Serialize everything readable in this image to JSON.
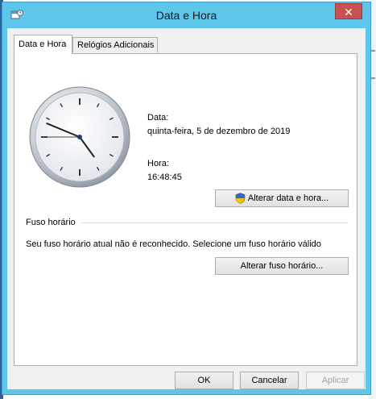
{
  "window": {
    "title": "Data e Hora",
    "close_glyph": "✕",
    "icon": "datetime-settings-icon"
  },
  "tabs": [
    {
      "label": "Data e Hora",
      "active": true
    },
    {
      "label": "Relógios Adicionais",
      "active": false
    }
  ],
  "clock": {
    "time": "16:48:45"
  },
  "date": {
    "label": "Data:",
    "value": "quinta-feira, 5 de dezembro de 2019"
  },
  "time": {
    "label": "Hora:",
    "value": "16:48:45"
  },
  "change_datetime_button": {
    "label": "Alterar data e hora...",
    "icon": "uac-shield-icon"
  },
  "timezone": {
    "group_label": "Fuso horário",
    "message": "Seu fuso horário atual não é reconhecido. Selecione um fuso horário válido",
    "button_label": "Alterar fuso horário..."
  },
  "footer": {
    "ok": "OK",
    "cancel": "Cancelar",
    "apply": "Aplicar",
    "apply_enabled": false
  },
  "colors": {
    "titlebar": "#5ec6ea",
    "close": "#c75050",
    "panel": "#ffffff",
    "dialog": "#f0f0f0"
  }
}
